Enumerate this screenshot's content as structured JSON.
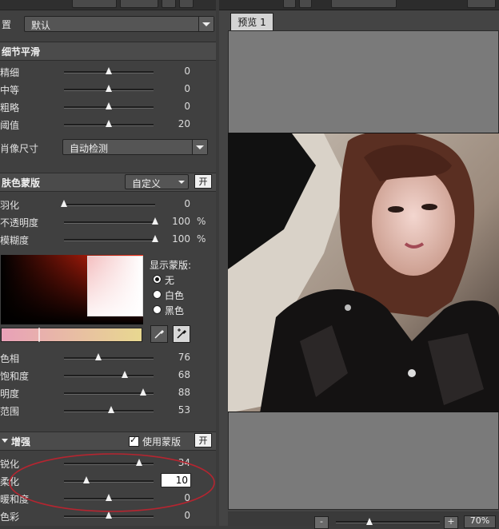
{
  "preset": {
    "label": "置",
    "value": "默认"
  },
  "detail_smooth": {
    "title": "细节平滑",
    "rows": [
      {
        "label": "精细",
        "value": "0",
        "pos": 0.5
      },
      {
        "label": "中等",
        "value": "0",
        "pos": 0.5
      },
      {
        "label": "粗略",
        "value": "0",
        "pos": 0.5
      },
      {
        "label": "阈值",
        "value": "20",
        "pos": 0.5
      }
    ],
    "portrait_size_label": "肖像尺寸",
    "portrait_size_value": "自动检测"
  },
  "skin_mask": {
    "title": "肤色蒙版",
    "mode_value": "自定义",
    "on_label": "开",
    "rows": [
      {
        "label": "羽化",
        "value": "0",
        "unit": "",
        "pos": 0.0
      },
      {
        "label": "不透明度",
        "value": "100",
        "unit": "%",
        "pos": 1.0
      },
      {
        "label": "模糊度",
        "value": "100",
        "unit": "%",
        "pos": 1.0
      }
    ],
    "show_mask_label": "显示蒙版:",
    "mask_options": [
      "无",
      "白色",
      "黑色"
    ],
    "mask_selected": 0,
    "color_rows": [
      {
        "label": "色相",
        "value": "76",
        "pos": 0.38
      },
      {
        "label": "饱和度",
        "value": "68",
        "pos": 0.68
      },
      {
        "label": "明度",
        "value": "88",
        "pos": 0.88
      },
      {
        "label": "范围",
        "value": "53",
        "pos": 0.53
      }
    ]
  },
  "enhance": {
    "title": "增强",
    "use_mask_label": "使用蒙版",
    "use_mask_checked": true,
    "on_label": "开",
    "rows": [
      {
        "label": "锐化",
        "value": "34",
        "pos": 0.84
      },
      {
        "label": "柔化",
        "value": "10",
        "pos": 0.25,
        "editing": true
      },
      {
        "label": "暖和度",
        "value": "0",
        "pos": 0.5
      },
      {
        "label": "色彩",
        "value": "0",
        "pos": 0.5
      }
    ]
  },
  "preview": {
    "tab_label": "预览 1",
    "zoom": "70%",
    "zoom_out": "-",
    "zoom_in": "+"
  },
  "colors": {
    "highlight_circle": "#c0212a",
    "gradient_left": "#e8a0b8",
    "gradient_right": "#e8d890"
  }
}
